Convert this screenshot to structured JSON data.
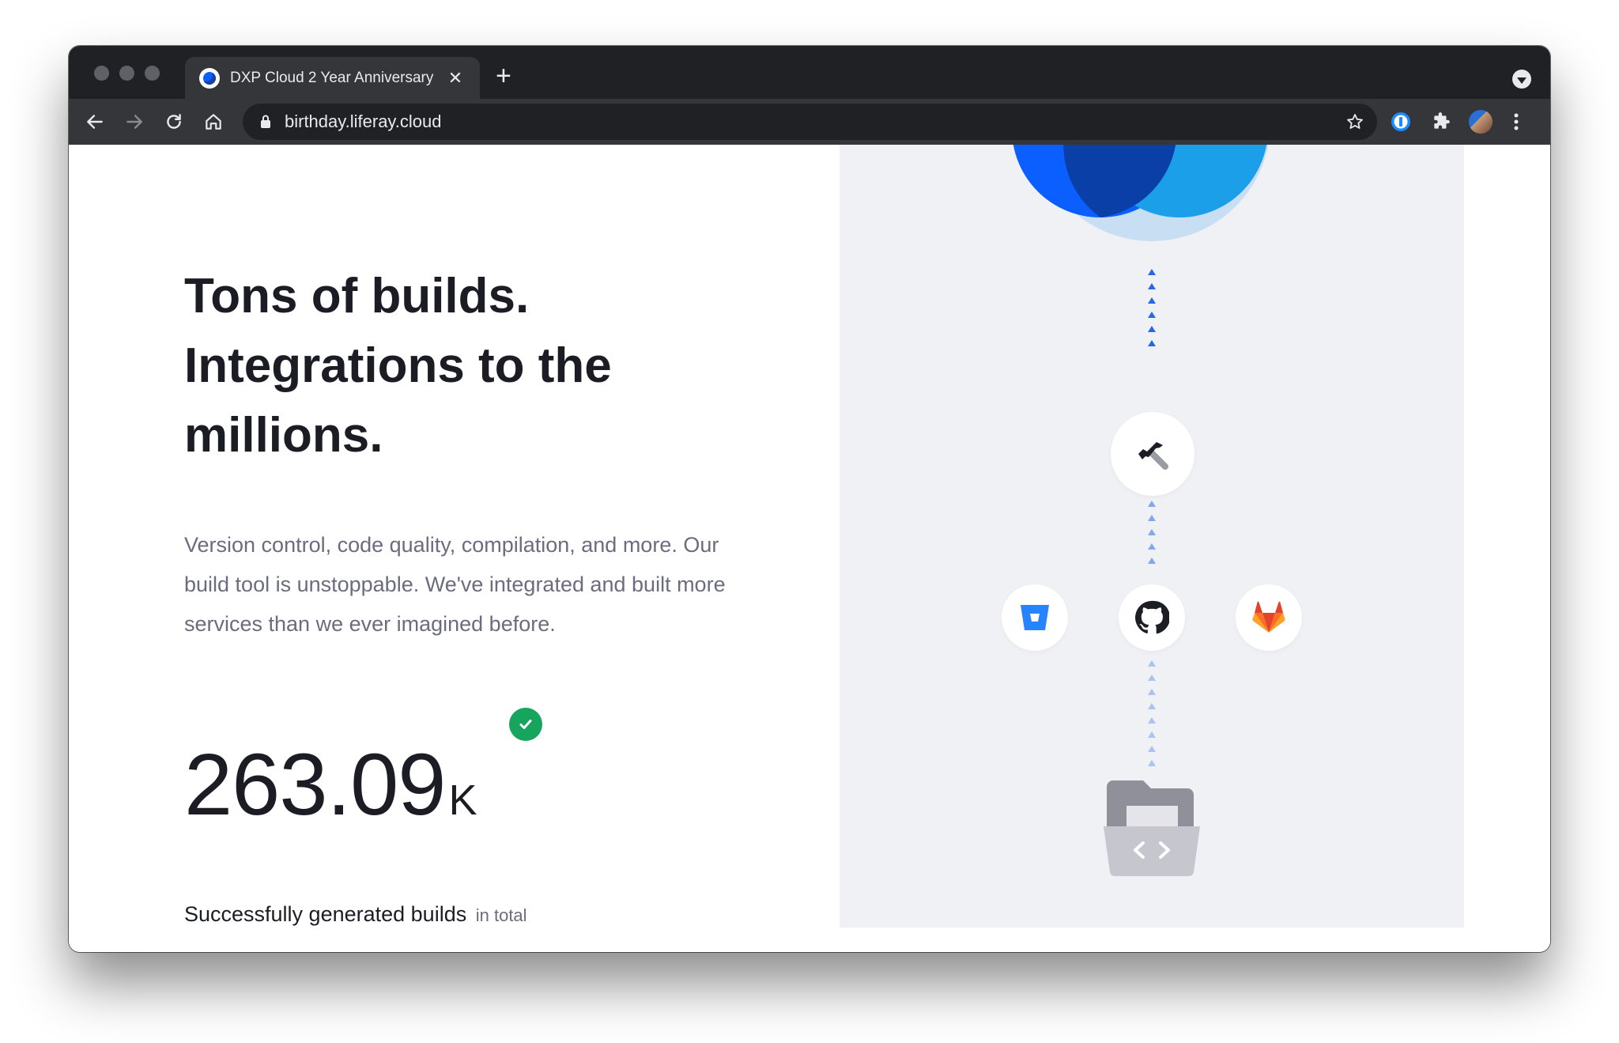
{
  "browser": {
    "tab": {
      "title": "DXP Cloud 2 Year Anniversary"
    },
    "address_bar": {
      "url": "birthday.liferay.cloud"
    }
  },
  "hero": {
    "headline_lines": [
      "Tons of builds.",
      "Integrations to the",
      "millions."
    ],
    "description": "Version control, code quality, compilation, and more. Our build tool is unstoppable. We've integrated and built more services than we ever imagined before.",
    "stat": {
      "value": "263.09",
      "unit": "K",
      "caption": "Successfully generated builds",
      "caption_suffix": "in total"
    }
  },
  "illustration": {
    "build_tool_icon": "hammer-icon",
    "integrations": [
      {
        "name": "bitbucket-icon",
        "color": "#2684ff"
      },
      {
        "name": "github-icon",
        "color": "#1b1f23"
      },
      {
        "name": "gitlab-icon",
        "color": "#e24329"
      }
    ],
    "repository_icon": "code-folder-icon",
    "colors": {
      "primary": "#0b5fff",
      "light": "#c8dff3",
      "panel": "#f0f1f5"
    }
  }
}
